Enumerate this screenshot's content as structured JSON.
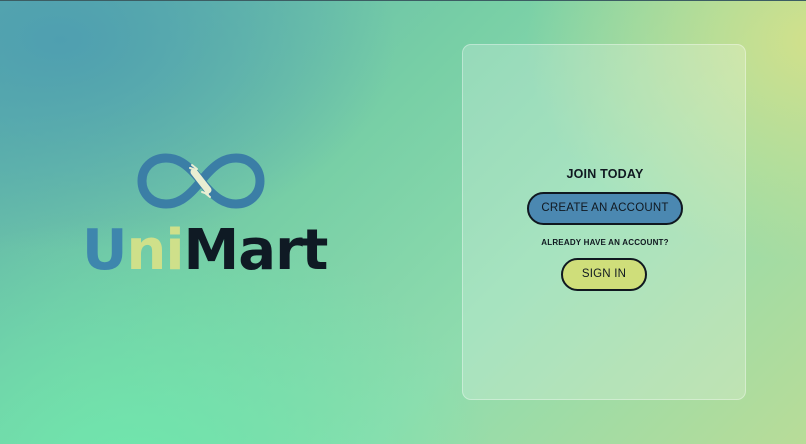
{
  "brand": {
    "name_part1": "U",
    "name_part2": "ni",
    "name_part3": "Mart",
    "colors": {
      "blue": "#3e86ad",
      "lime": "#cfe08a",
      "dark": "#0f1a24"
    }
  },
  "auth_card": {
    "title": "JOIN TODAY",
    "create_account_label": "CREATE AN ACCOUNT",
    "already_have_account_text": "ALREADY HAVE AN ACCOUNT?",
    "sign_in_label": "SIGN IN",
    "colors": {
      "create_button": "#4b88b1",
      "sign_in_button": "#cfde7a"
    }
  },
  "icons": {
    "logo": "infinity-hands-icon"
  }
}
